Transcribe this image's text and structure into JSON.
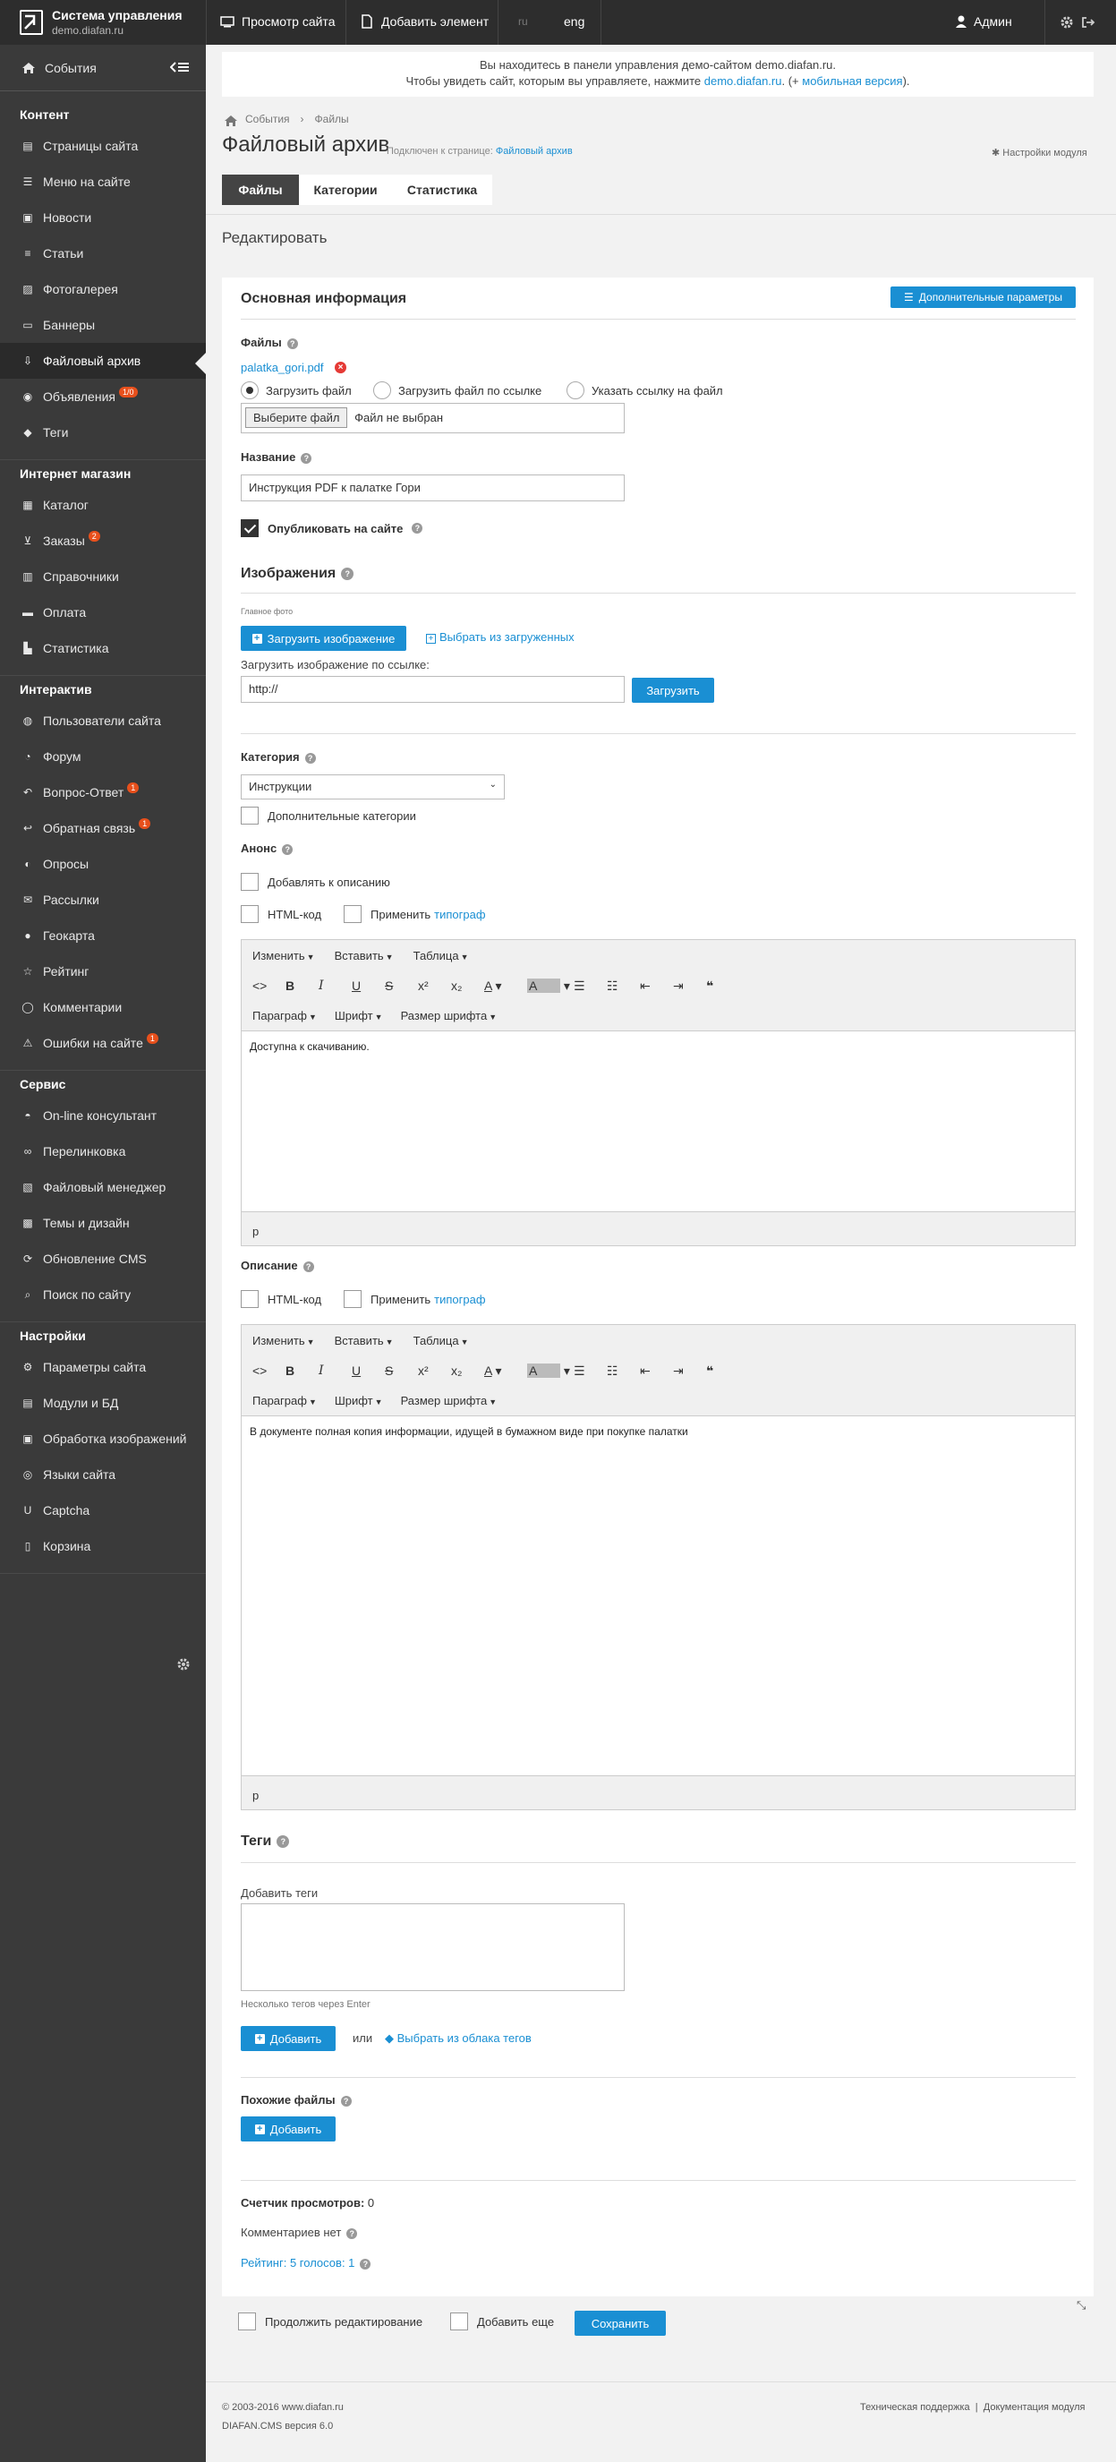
{
  "topbar": {
    "logo_title": "Система управления",
    "logo_sub": "demo.diafan.ru",
    "view_site": "Просмотр сайта",
    "add_element": "Добавить элемент",
    "lang_ru": "ru",
    "lang_eng": "eng",
    "admin": "Админ"
  },
  "sidebar": {
    "events": "События",
    "sections": [
      {
        "title": "Контент",
        "items": [
          {
            "label": "Страницы сайта",
            "icon": "file-icon"
          },
          {
            "label": "Меню на сайте",
            "icon": "menu-icon"
          },
          {
            "label": "Новости",
            "icon": "news-icon"
          },
          {
            "label": "Статьи",
            "icon": "article-icon"
          },
          {
            "label": "Фотогалерея",
            "icon": "photo-icon"
          },
          {
            "label": "Баннеры",
            "icon": "banner-icon"
          },
          {
            "label": "Файловый архив",
            "icon": "download-icon",
            "active": true
          },
          {
            "label": "Объявления",
            "icon": "ads-icon",
            "badge": "1/0"
          },
          {
            "label": "Теги",
            "icon": "tag-icon"
          }
        ]
      },
      {
        "title": "Интернет магазин",
        "items": [
          {
            "label": "Каталог",
            "icon": "catalog-icon"
          },
          {
            "label": "Заказы",
            "icon": "cart-icon",
            "badge": "2"
          },
          {
            "label": "Справочники",
            "icon": "book-icon"
          },
          {
            "label": "Оплата",
            "icon": "payment-icon"
          },
          {
            "label": "Статистика",
            "icon": "stats-icon"
          }
        ]
      },
      {
        "title": "Интерактив",
        "items": [
          {
            "label": "Пользователи сайта",
            "icon": "users-icon"
          },
          {
            "label": "Форум",
            "icon": "forum-icon"
          },
          {
            "label": "Вопрос-Ответ",
            "icon": "reply-icon",
            "badge": "1"
          },
          {
            "label": "Обратная связь",
            "icon": "feedback-icon",
            "badge": "1"
          },
          {
            "label": "Опросы",
            "icon": "poll-icon"
          },
          {
            "label": "Рассылки",
            "icon": "mail-icon"
          },
          {
            "label": "Геокарта",
            "icon": "map-marker-icon"
          },
          {
            "label": "Рейтинг",
            "icon": "star-icon"
          },
          {
            "label": "Комментарии",
            "icon": "comment-icon"
          },
          {
            "label": "Ошибки на сайте",
            "icon": "error-icon",
            "badge": "1"
          }
        ]
      },
      {
        "title": "Сервис",
        "items": [
          {
            "label": "On-line консультант",
            "icon": "consultant-icon"
          },
          {
            "label": "Перелинковка",
            "icon": "link-icon"
          },
          {
            "label": "Файловый менеджер",
            "icon": "file-manager-icon"
          },
          {
            "label": "Темы и дизайн",
            "icon": "theme-icon"
          },
          {
            "label": "Обновление CMS",
            "icon": "update-icon"
          },
          {
            "label": "Поиск по сайту",
            "icon": "search-icon"
          }
        ]
      },
      {
        "title": "Настройки",
        "items": [
          {
            "label": "Параметры сайта",
            "icon": "params-icon"
          },
          {
            "label": "Модули и БД",
            "icon": "modules-icon"
          },
          {
            "label": "Обработка изображений",
            "icon": "image-process-icon"
          },
          {
            "label": "Языки сайта",
            "icon": "language-icon"
          },
          {
            "label": "Captcha",
            "icon": "captcha-icon"
          },
          {
            "label": "Корзина",
            "icon": "trash-icon"
          }
        ]
      }
    ]
  },
  "notice": {
    "line1": "Вы находитесь в панели управления демо-сайтом demo.diafan.ru.",
    "line2_pre": "Чтобы увидеть сайт, которым вы управляете, нажмите",
    "line2_link": "demo.diafan.ru",
    "line2_mid": ". (+",
    "line2_link2": "мобильная версия",
    "line2_end": ")."
  },
  "header": {
    "breadcrumb": [
      "События",
      "Файлы"
    ],
    "title": "Файловый архив",
    "attached_label": "Подключен к странице:",
    "attached_link": "Файловый архив",
    "module_settings": "Настройки модуля",
    "tabs": [
      "Файлы",
      "Категории",
      "Статистика"
    ],
    "edit_title": "Редактировать"
  },
  "form": {
    "main_info": "Основная информация",
    "extra_params": "Дополнительные параметры",
    "files_label": "Файлы",
    "file_name": "palatka_gori.pdf",
    "upload_options": [
      "Загрузить файл",
      "Загрузить файл по ссылке",
      "Указать ссылку на файл"
    ],
    "choose_file": "Выберите файл",
    "no_file": "Файл не выбран",
    "name_label": "Название",
    "name_value": "Инструкция PDF к палатке Гори",
    "publish": "Опубликовать на сайте",
    "images_title": "Изображения",
    "main_photo": "Главное фото",
    "upload_image": "Загрузить изображение",
    "choose_uploaded": "Выбрать из загруженных",
    "upload_by_link": "Загрузить изображение по ссылке:",
    "url_value": "http://",
    "upload_btn": "Загрузить",
    "category_label": "Категория",
    "category_value": "Инструкции",
    "extra_categories": "Дополнительные категории",
    "anons_label": "Анонс",
    "add_to_desc": "Добавлять к описанию",
    "html_code": "HTML-код",
    "apply": "Применить",
    "typograph": "типограф",
    "anons_text": "Доступна к скачиванию.",
    "desc_label": "Описание",
    "desc_text": "В документе полная копия информации, идущей в бумажном виде при покупке палатки",
    "editor_menu": [
      "Изменить",
      "Вставить",
      "Таблица"
    ],
    "editor_fmt": [
      "Параграф",
      "Шрифт",
      "Размер шрифта"
    ],
    "editor_status": "p",
    "tags_title": "Теги",
    "add_tags": "Добавить теги",
    "tags_hint": "Несколько тегов через Enter",
    "add": "Добавить",
    "or": "или",
    "choose_cloud": "Выбрать из облака тегов",
    "similar_files": "Похожие файлы",
    "views_label": "Счетчик просмотров:",
    "views_value": "0",
    "no_comments": "Комментариев нет",
    "rating": "Рейтинг: 5 голосов: 1"
  },
  "bottom": {
    "continue_edit": "Продолжить редактирование",
    "add_more": "Добавить еще",
    "save": "Сохранить"
  },
  "footer": {
    "copyright": "© 2003-2016 www.diafan.ru",
    "version": "DIAFAN.CMS версия 6.0",
    "support": "Техническая поддержка",
    "docs": "Документация модуля"
  },
  "colors": {
    "accent": "#1a8fd3",
    "sidebar": "#3a3a3a",
    "topbar": "#2d2d2d",
    "badge": "#e8501c",
    "delete": "#e53935"
  }
}
